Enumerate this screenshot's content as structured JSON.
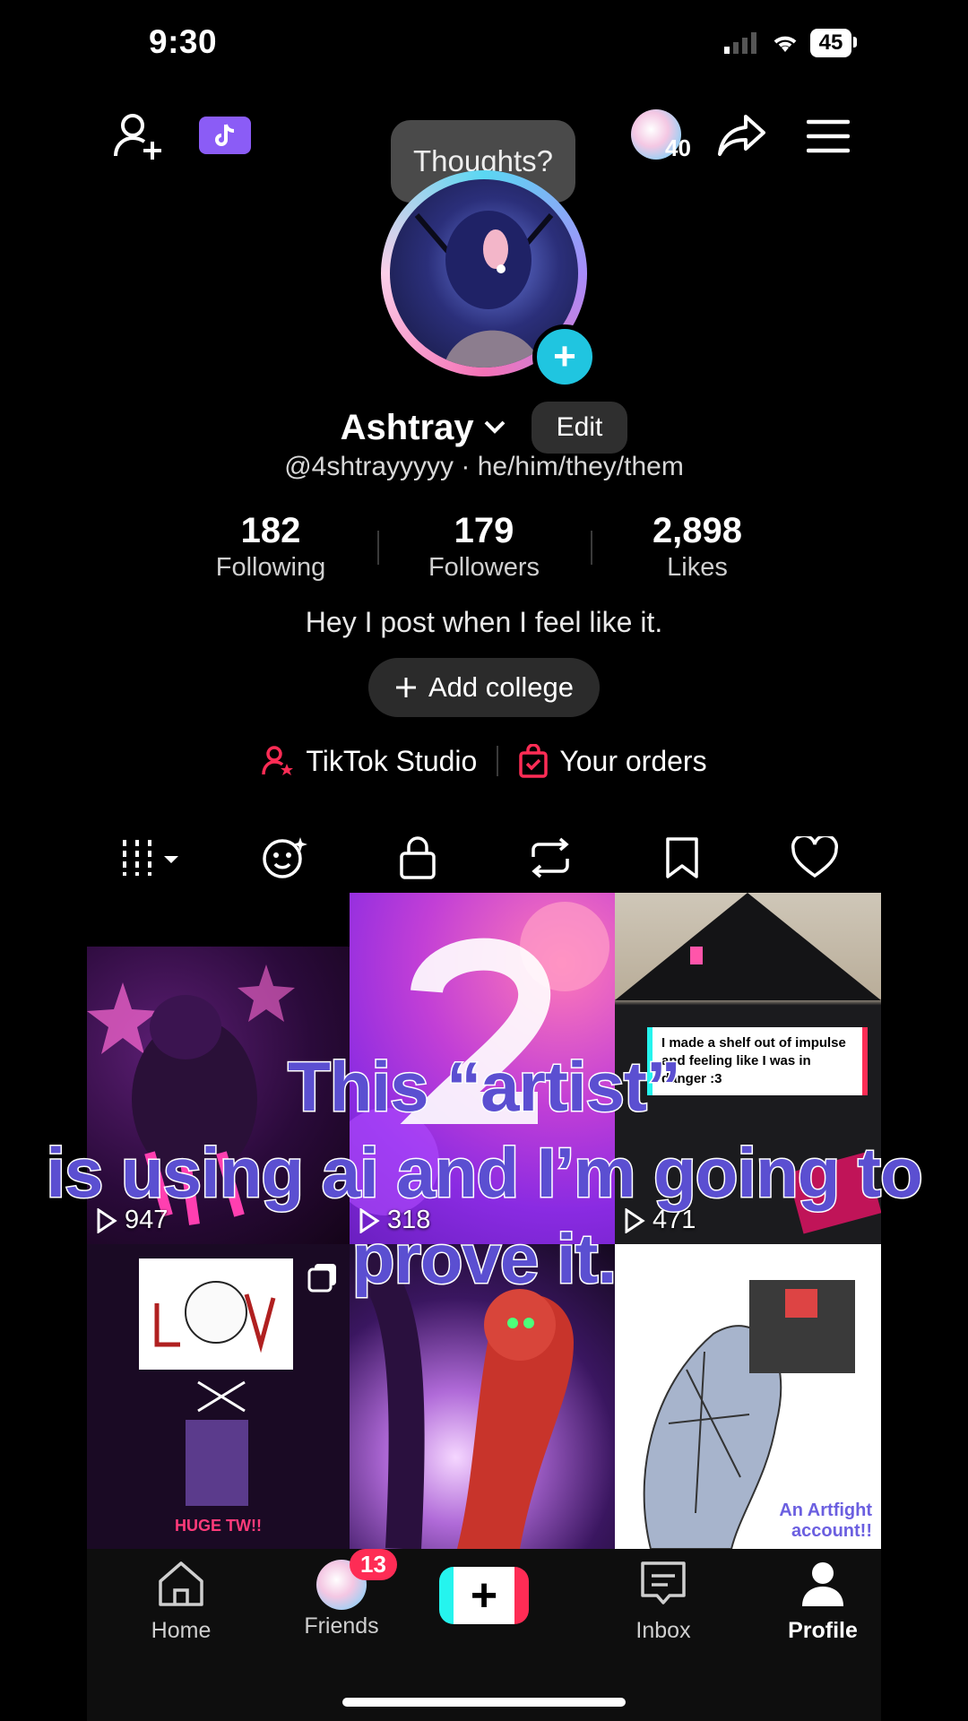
{
  "status_bar": {
    "time": "9:30",
    "battery": "45"
  },
  "tooltip": "Thoughts?",
  "profile": {
    "display_name": "Ashtray",
    "edit_label": "Edit",
    "handle": "@4shtrayyyyy",
    "pronouns": "· he/him/they/them",
    "bio": "Hey I post when I feel like it.",
    "add_college": "Add college",
    "coins": "40"
  },
  "stats": [
    {
      "value": "182",
      "label": "Following"
    },
    {
      "value": "179",
      "label": "Followers"
    },
    {
      "value": "2,898",
      "label": "Likes"
    }
  ],
  "links": {
    "studio": "TikTok Studio",
    "orders": "Your orders"
  },
  "videos": [
    {
      "plays": "947"
    },
    {
      "plays": "318"
    },
    {
      "plays": "471"
    }
  ],
  "video_captions": {
    "v3": "I made a shelf out of impulse and feeling like I was in danger :3",
    "v4": "HUGE TW!!",
    "v6": "An Artfight account!!"
  },
  "overlay_caption": [
    "This “artist”",
    "is using ai and I’m going to",
    "prove it."
  ],
  "bottom_nav": {
    "home": "Home",
    "friends": "Friends",
    "friends_badge": "13",
    "inbox": "Inbox",
    "profile": "Profile"
  },
  "colors": {
    "accent": "#fe2c55",
    "cyan": "#25f4ee",
    "overlay_text": "#5b4fd1"
  }
}
